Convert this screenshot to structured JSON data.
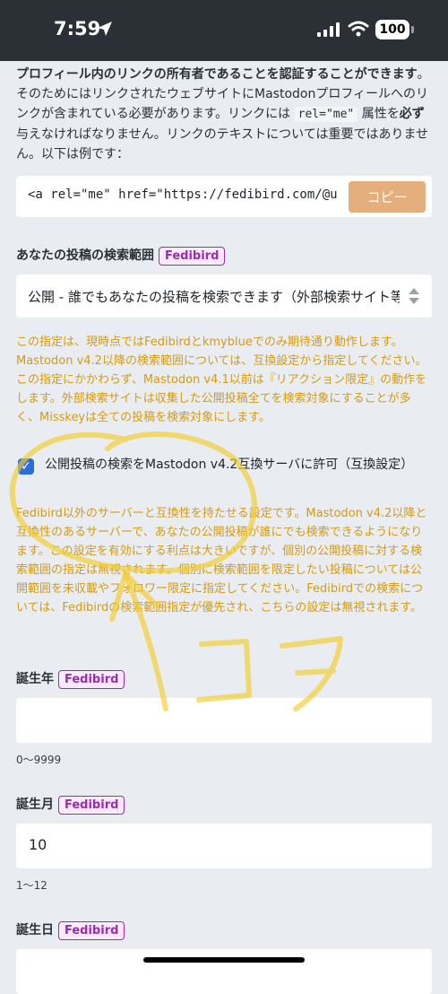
{
  "status": {
    "time": "7:59",
    "battery": "100"
  },
  "intro": {
    "bold": "プロフィール内のリンクの所有者であることを認証することができます",
    "p1": "。そのためにはリンクされたウェブサイトにMastodonプロフィールへのリンクが含まれている必要があります。リンクには",
    "code": "rel=\"me\"",
    "p2": "属性を",
    "must": "必ず",
    "p3": "与えなければなりません。リンクのテキストについては重要ではありません。以下は例です："
  },
  "example": {
    "code": "<a rel=\"me\" href=\"https://fedibird.com/@user\">Mastodon</a>",
    "copy_label": "コピー"
  },
  "search_range": {
    "label": "あなたの投稿の検索範囲",
    "badge": "Fedibird",
    "selected": "公開 - 誰でもあなたの投稿を検索できます（外部検索サイト等を含む）",
    "hint": "この指定は、現時点ではFedibirdとkmyblueでのみ期待通り動作します。Mastodon v4.2以降の検索範囲については、互換設定から指定してください。この指定にかかわらず、Mastodon v4.1以前は『リアクション限定』の動作をします。外部検索サイトは収集した公開投稿全てを検索対象にすることが多く、Misskeyは全ての投稿を検索対象にします。"
  },
  "compat": {
    "label": "公開投稿の検索をMastodon v4.2互換サーバに許可（互換設定）",
    "checked": true,
    "hint": "Fedibird以外のサーバーと互換性を持たせる設定です。Mastodon v4.2以降と互換性のあるサーバーで、あなたの公開投稿が誰にでも検索できるようになります。この設定を有効にする利点は大きいですが、個別の公開投稿に対する検索範囲の指定は無視されます。個別に検索範囲を限定したい投稿については公開範囲を未収載やフォロワー限定に指定してください。Fedibirdでの検索については、Fedibirdの検索範囲指定が優先され、こちらの設定は無視されます。"
  },
  "birth_year": {
    "label": "誕生年",
    "badge": "Fedibird",
    "value": "",
    "hint": "0〜9999"
  },
  "birth_month": {
    "label": "誕生月",
    "badge": "Fedibird",
    "value": "10",
    "hint": "1〜12"
  },
  "birth_day": {
    "label": "誕生日",
    "badge": "Fedibird",
    "value": ""
  },
  "annotation_note": "ココ",
  "colors": {
    "accent": "#e4ae7d",
    "warning": "#d49b14",
    "badge": "#9b2bb0",
    "checkbox": "#2a6edc",
    "highlighter": "#f5cd2b"
  },
  "icons": [
    "location-arrow-icon",
    "signal-icon",
    "wifi-icon",
    "battery-icon",
    "check-icon",
    "select-arrows-icon"
  ]
}
